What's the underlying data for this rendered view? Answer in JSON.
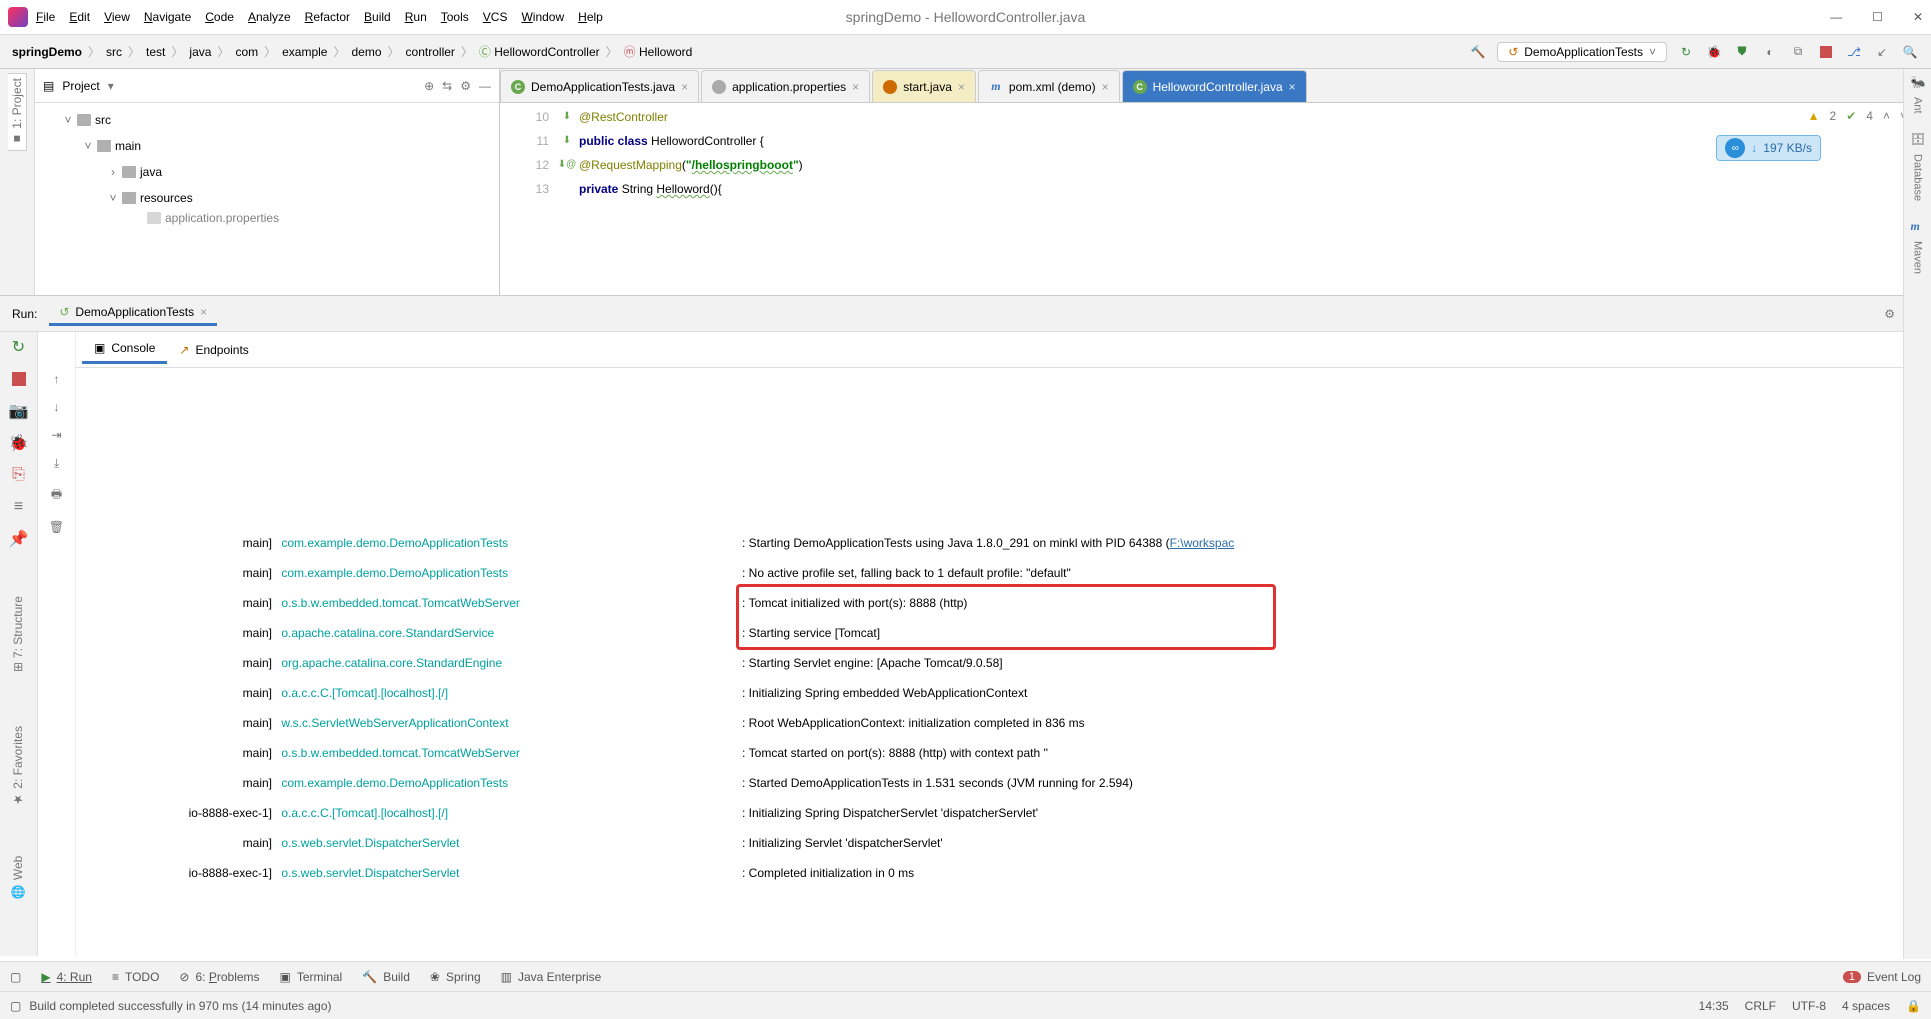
{
  "title": "springDemo - HellowordController.java",
  "menus": [
    "File",
    "Edit",
    "View",
    "Navigate",
    "Code",
    "Analyze",
    "Refactor",
    "Build",
    "Run",
    "Tools",
    "VCS",
    "Window",
    "Help"
  ],
  "menu_underlines": [
    "F",
    "E",
    "V",
    "N",
    "C",
    "A",
    "R",
    "B",
    "R",
    "T",
    "V",
    "W",
    "H"
  ],
  "breadcrumb": [
    "springDemo",
    "src",
    "test",
    "java",
    "com",
    "example",
    "demo",
    "controller",
    "HellowordController",
    "Helloword"
  ],
  "run_config": "DemoApplicationTests",
  "project_panel": {
    "title": "Project",
    "tree": [
      {
        "depth": 0,
        "chev": "˅",
        "label": "src"
      },
      {
        "depth": 1,
        "chev": "˅",
        "label": "main"
      },
      {
        "depth": 2,
        "chev": "›",
        "label": "java"
      },
      {
        "depth": 2,
        "chev": "˅",
        "label": "resources"
      },
      {
        "depth": 3,
        "chev": "",
        "label": "application.properties",
        "cut": true
      }
    ]
  },
  "editor_tabs": [
    {
      "label": "DemoApplicationTests.java",
      "type": "c",
      "style": "plain"
    },
    {
      "label": "application.properties",
      "type": "gear",
      "style": "plain"
    },
    {
      "label": "start.java",
      "type": "j",
      "style": "yellow"
    },
    {
      "label": "pom.xml (demo)",
      "type": "m",
      "style": "plain"
    },
    {
      "label": "HellowordController.java",
      "type": "c",
      "style": "active"
    }
  ],
  "code": {
    "lines": [
      {
        "n": 10,
        "g": "⬇",
        "html": "<span class='ann'>@RestController</span>"
      },
      {
        "n": 11,
        "g": "⬇",
        "html": "<span class='kw'>public class</span> <span class='cls'>HellowordController</span> {"
      },
      {
        "n": 12,
        "g": "",
        "html": "    <span class='ann'>@RequestMapping</span>(<span class='str'>\"<span class='underline'>/hellospringbooot</span>\"</span>)"
      },
      {
        "n": 13,
        "g": "⬇@",
        "html": "    <span class='kw'>private</span> String <span class='underline'>Helloword</span>(){"
      }
    ],
    "inspections": {
      "warn": "2",
      "ok": "4"
    },
    "speed": "197 KB/s"
  },
  "run": {
    "title": "Run:",
    "config": "DemoApplicationTests",
    "tabs": [
      "Console",
      "Endpoints"
    ],
    "console_lines": [
      {
        "thread": "main]",
        "logger": "com.example.demo.DemoApplicationTests",
        "msg": "Starting DemoApplicationTests using Java 1.8.0_291 on minkl with PID 64388 (",
        "link": "F:\\workspac"
      },
      {
        "thread": "main]",
        "logger": "com.example.demo.DemoApplicationTests",
        "msg": "No active profile set, falling back to 1 default profile: \"default\""
      },
      {
        "thread": "main]",
        "logger": "o.s.b.w.embedded.tomcat.TomcatWebServer",
        "msg": "Tomcat initialized with port(s): 8888 (http)",
        "hl": true
      },
      {
        "thread": "main]",
        "logger": "o.apache.catalina.core.StandardService",
        "msg": "Starting service [Tomcat]",
        "hl": true
      },
      {
        "thread": "main]",
        "logger": "org.apache.catalina.core.StandardEngine",
        "msg": "Starting Servlet engine: [Apache Tomcat/9.0.58]"
      },
      {
        "thread": "main]",
        "logger": "o.a.c.c.C.[Tomcat].[localhost].[/]",
        "msg": "Initializing Spring embedded WebApplicationContext"
      },
      {
        "thread": "main]",
        "logger": "w.s.c.ServletWebServerApplicationContext",
        "msg": "Root WebApplicationContext: initialization completed in 836 ms"
      },
      {
        "thread": "main]",
        "logger": "o.s.b.w.embedded.tomcat.TomcatWebServer",
        "msg": "Tomcat started on port(s): 8888 (http) with context path ''"
      },
      {
        "thread": "main]",
        "logger": "com.example.demo.DemoApplicationTests",
        "msg": "Started DemoApplicationTests in 1.531 seconds (JVM running for 2.594)"
      },
      {
        "thread": "io-8888-exec-1]",
        "logger": "o.a.c.c.C.[Tomcat].[localhost].[/]",
        "msg": "Initializing Spring DispatcherServlet 'dispatcherServlet'"
      },
      {
        "thread": "main]",
        "logger": "o.s.web.servlet.DispatcherServlet",
        "msg": "Initializing Servlet 'dispatcherServlet'"
      },
      {
        "thread": "io-8888-exec-1]",
        "logger": "o.s.web.servlet.DispatcherServlet",
        "msg": "Completed initialization in 0 ms"
      }
    ]
  },
  "bottom_tools": [
    {
      "icon": "▶",
      "label": "4: Run",
      "underline": "R",
      "active": true
    },
    {
      "icon": "≡",
      "label": "TODO"
    },
    {
      "icon": "⊘",
      "label": "6: Problems",
      "underline": "P"
    },
    {
      "icon": "▣",
      "label": "Terminal"
    },
    {
      "icon": "🔨",
      "label": "Build"
    },
    {
      "icon": "❀",
      "label": "Spring"
    },
    {
      "icon": "▥",
      "label": "Java Enterprise"
    }
  ],
  "event_log": {
    "count": "1",
    "label": "Event Log"
  },
  "status": {
    "msg": "Build completed successfully in 970 ms (14 minutes ago)",
    "time": "14:35",
    "eol": "CRLF",
    "enc": "UTF-8",
    "indent": "4 spaces"
  },
  "left_tabs": {
    "project": "1: Project"
  },
  "right_tabs": [
    "Ant",
    "Database",
    "Maven"
  ],
  "left_vtabs": {
    "structure": "7: Structure",
    "favorites": "2: Favorites",
    "web": "Web"
  }
}
